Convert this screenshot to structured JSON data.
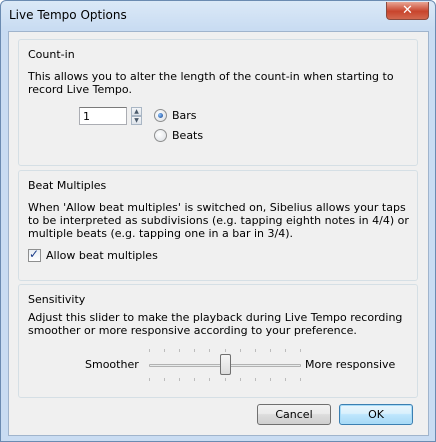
{
  "window": {
    "title": "Live Tempo Options",
    "close_glyph": "✕"
  },
  "count_in": {
    "title": "Count-in",
    "description": "This allows you to alter the length of the count-in when starting to record Live Tempo.",
    "value": "1",
    "spin_up": "▲",
    "spin_down": "▼",
    "options": [
      {
        "label": "Bars",
        "checked": true
      },
      {
        "label": "Beats",
        "checked": false
      }
    ]
  },
  "beat_multiples": {
    "title": "Beat Multiples",
    "description": "When 'Allow beat multiples' is switched on, Sibelius allows your taps to be interpreted as subdivisions (e.g. tapping eighth notes in 4/4) or multiple beats (e.g. tapping one in a bar in 3/4).",
    "checkbox_label": "Allow beat multiples",
    "checkbox_checked": true,
    "check_glyph": "✓"
  },
  "sensitivity": {
    "title": "Sensitivity",
    "description": "Adjust this slider to make the playback during Live Tempo recording smoother or more responsive according to your preference.",
    "left_label": "Smoother",
    "right_label": "More responsive",
    "slider_value": 0.5
  },
  "buttons": {
    "cancel": "Cancel",
    "ok": "OK"
  }
}
